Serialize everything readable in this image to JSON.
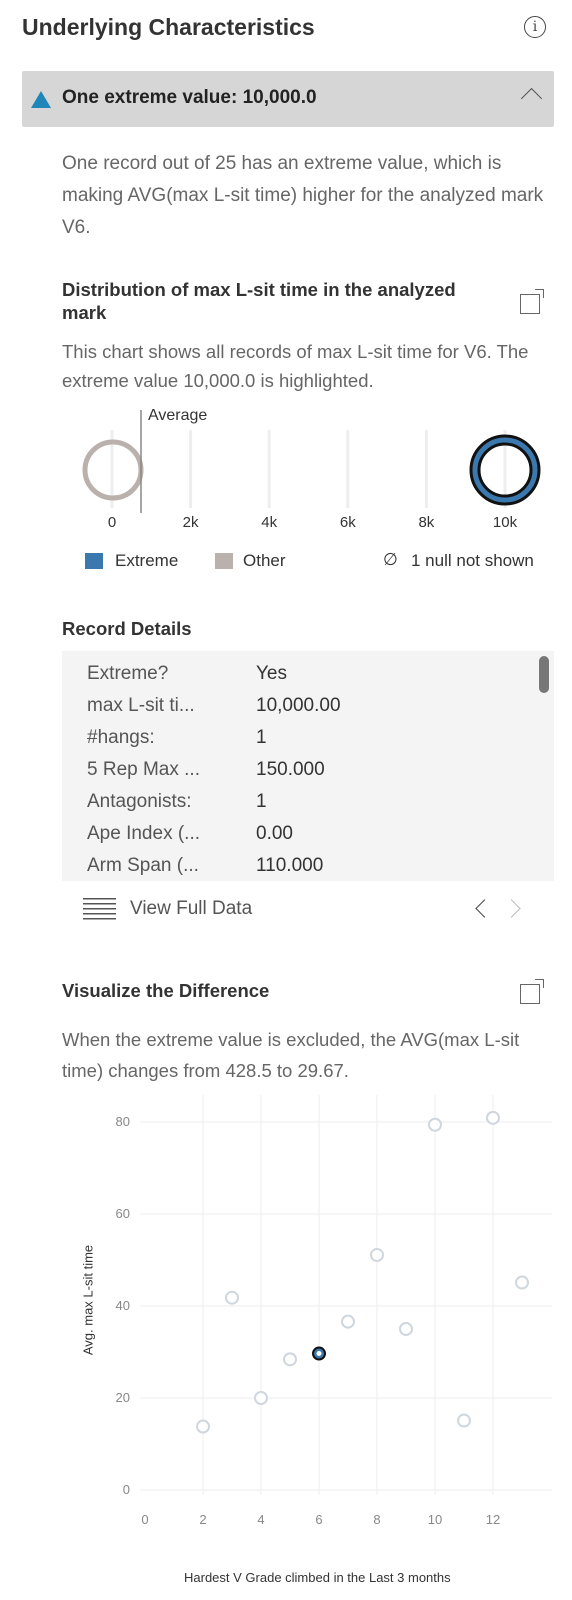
{
  "header": {
    "title": "Underlying Characteristics",
    "info_icon": "info-icon"
  },
  "accordion": {
    "label": "One extreme value: 10,000.0",
    "icon": "triangle-up-icon",
    "accent": "#1f86b9",
    "chevron": "chevron-up-icon"
  },
  "summary": "One record out of 25 has an extreme value, which is making AVG(max L-sit time) higher for the analyzed mark V6.",
  "distribution": {
    "title": "Distribution of max L-sit time in the analyzed mark",
    "description": "This chart shows all records of max L-sit time for V6. The extreme value 10,000.0 is highlighted.",
    "average_label": "Average",
    "legend": {
      "extreme": "Extreme",
      "other": "Other",
      "null_note": "1 null not shown"
    },
    "colors": {
      "extreme": "#3a78ad",
      "other": "#bab0ac"
    }
  },
  "records": {
    "title": "Record Details",
    "rows": [
      {
        "key": "Extreme?",
        "value": "Yes"
      },
      {
        "key": "max L-sit ti...",
        "value": "10,000.00"
      },
      {
        "key": "#hangs:",
        "value": "1"
      },
      {
        "key": "5 Rep Max ...",
        "value": "150.000"
      },
      {
        "key": "Antagonists:",
        "value": "1"
      },
      {
        "key": "Ape Index (...",
        "value": "0.00"
      },
      {
        "key": "Arm Span (...",
        "value": "110.000"
      }
    ],
    "view_full_data": "View Full Data"
  },
  "difference": {
    "title": "Visualize the Difference",
    "description": "When the extreme value is excluded, the AVG(max L-sit time) changes from 428.5 to 29.67."
  },
  "chart_data": [
    {
      "type": "scatter",
      "title": "",
      "xlabel": "",
      "ylabel": "",
      "x_ticks": [
        "0",
        "2k",
        "4k",
        "6k",
        "8k",
        "10k"
      ],
      "xlim": [
        0,
        10000
      ],
      "average": 428.5,
      "series": [
        {
          "name": "Other",
          "values": [
            0
          ]
        },
        {
          "name": "Extreme",
          "values": [
            10000
          ]
        }
      ]
    },
    {
      "type": "scatter",
      "xlabel": "Hardest V Grade climbed in the Last 3 months",
      "ylabel": "Avg. max L-sit time",
      "xlim": [
        0,
        13.5
      ],
      "ylim": [
        0,
        80
      ],
      "x_ticks": [
        0,
        2,
        4,
        6,
        8,
        10,
        12
      ],
      "y_ticks": [
        0,
        20,
        40,
        60,
        80
      ],
      "grid": true,
      "points": [
        {
          "x": 2,
          "y": 13.8
        },
        {
          "x": 3,
          "y": 41.8
        },
        {
          "x": 4,
          "y": 20
        },
        {
          "x": 5,
          "y": 28.4
        },
        {
          "x": 6,
          "y": 29.67,
          "highlighted": true
        },
        {
          "x": 7,
          "y": 36.6
        },
        {
          "x": 8,
          "y": 51.1
        },
        {
          "x": 9,
          "y": 35
        },
        {
          "x": 10,
          "y": 79.4
        },
        {
          "x": 11,
          "y": 15.1
        },
        {
          "x": 12,
          "y": 80.9
        },
        {
          "x": 13,
          "y": 45.1
        }
      ]
    }
  ]
}
